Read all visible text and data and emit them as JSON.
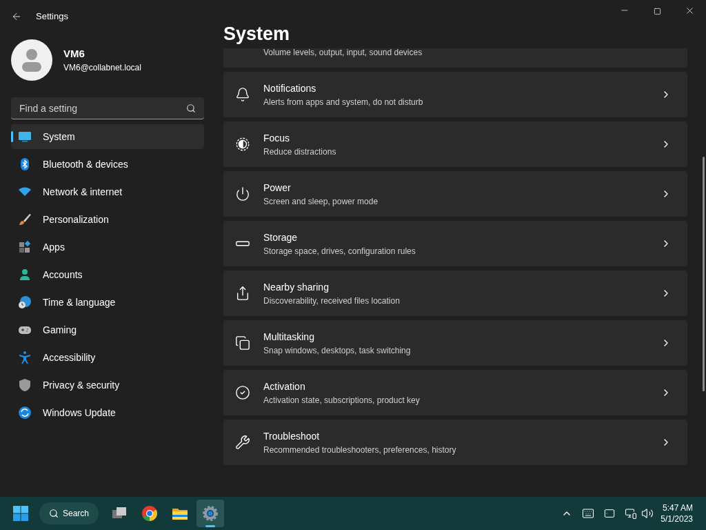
{
  "window": {
    "title": "Settings"
  },
  "account": {
    "name": "VM6",
    "email": "VM6@collabnet.local"
  },
  "search": {
    "placeholder": "Find a setting"
  },
  "sidebar": {
    "items": [
      {
        "label": "System",
        "selected": true
      },
      {
        "label": "Bluetooth & devices",
        "selected": false
      },
      {
        "label": "Network & internet",
        "selected": false
      },
      {
        "label": "Personalization",
        "selected": false
      },
      {
        "label": "Apps",
        "selected": false
      },
      {
        "label": "Accounts",
        "selected": false
      },
      {
        "label": "Time & language",
        "selected": false
      },
      {
        "label": "Gaming",
        "selected": false
      },
      {
        "label": "Accessibility",
        "selected": false
      },
      {
        "label": "Privacy & security",
        "selected": false
      },
      {
        "label": "Windows Update",
        "selected": false
      }
    ]
  },
  "page": {
    "title": "System",
    "partial_card": {
      "description": "Volume levels, output, input, sound devices"
    },
    "cards": [
      {
        "title": "Notifications",
        "description": "Alerts from apps and system, do not disturb"
      },
      {
        "title": "Focus",
        "description": "Reduce distractions"
      },
      {
        "title": "Power",
        "description": "Screen and sleep, power mode"
      },
      {
        "title": "Storage",
        "description": "Storage space, drives, configuration rules"
      },
      {
        "title": "Nearby sharing",
        "description": "Discoverability, received files location"
      },
      {
        "title": "Multitasking",
        "description": "Snap windows, desktops, task switching"
      },
      {
        "title": "Activation",
        "description": "Activation state, subscriptions, product key"
      },
      {
        "title": "Troubleshoot",
        "description": "Recommended troubleshooters, preferences, history"
      }
    ]
  },
  "taskbar": {
    "search_label": "Search",
    "apps": [
      {
        "selected": false
      },
      {
        "selected": false
      },
      {
        "selected": false
      },
      {
        "selected": true
      }
    ],
    "time": "5:47 AM",
    "date": "5/1/2023"
  }
}
